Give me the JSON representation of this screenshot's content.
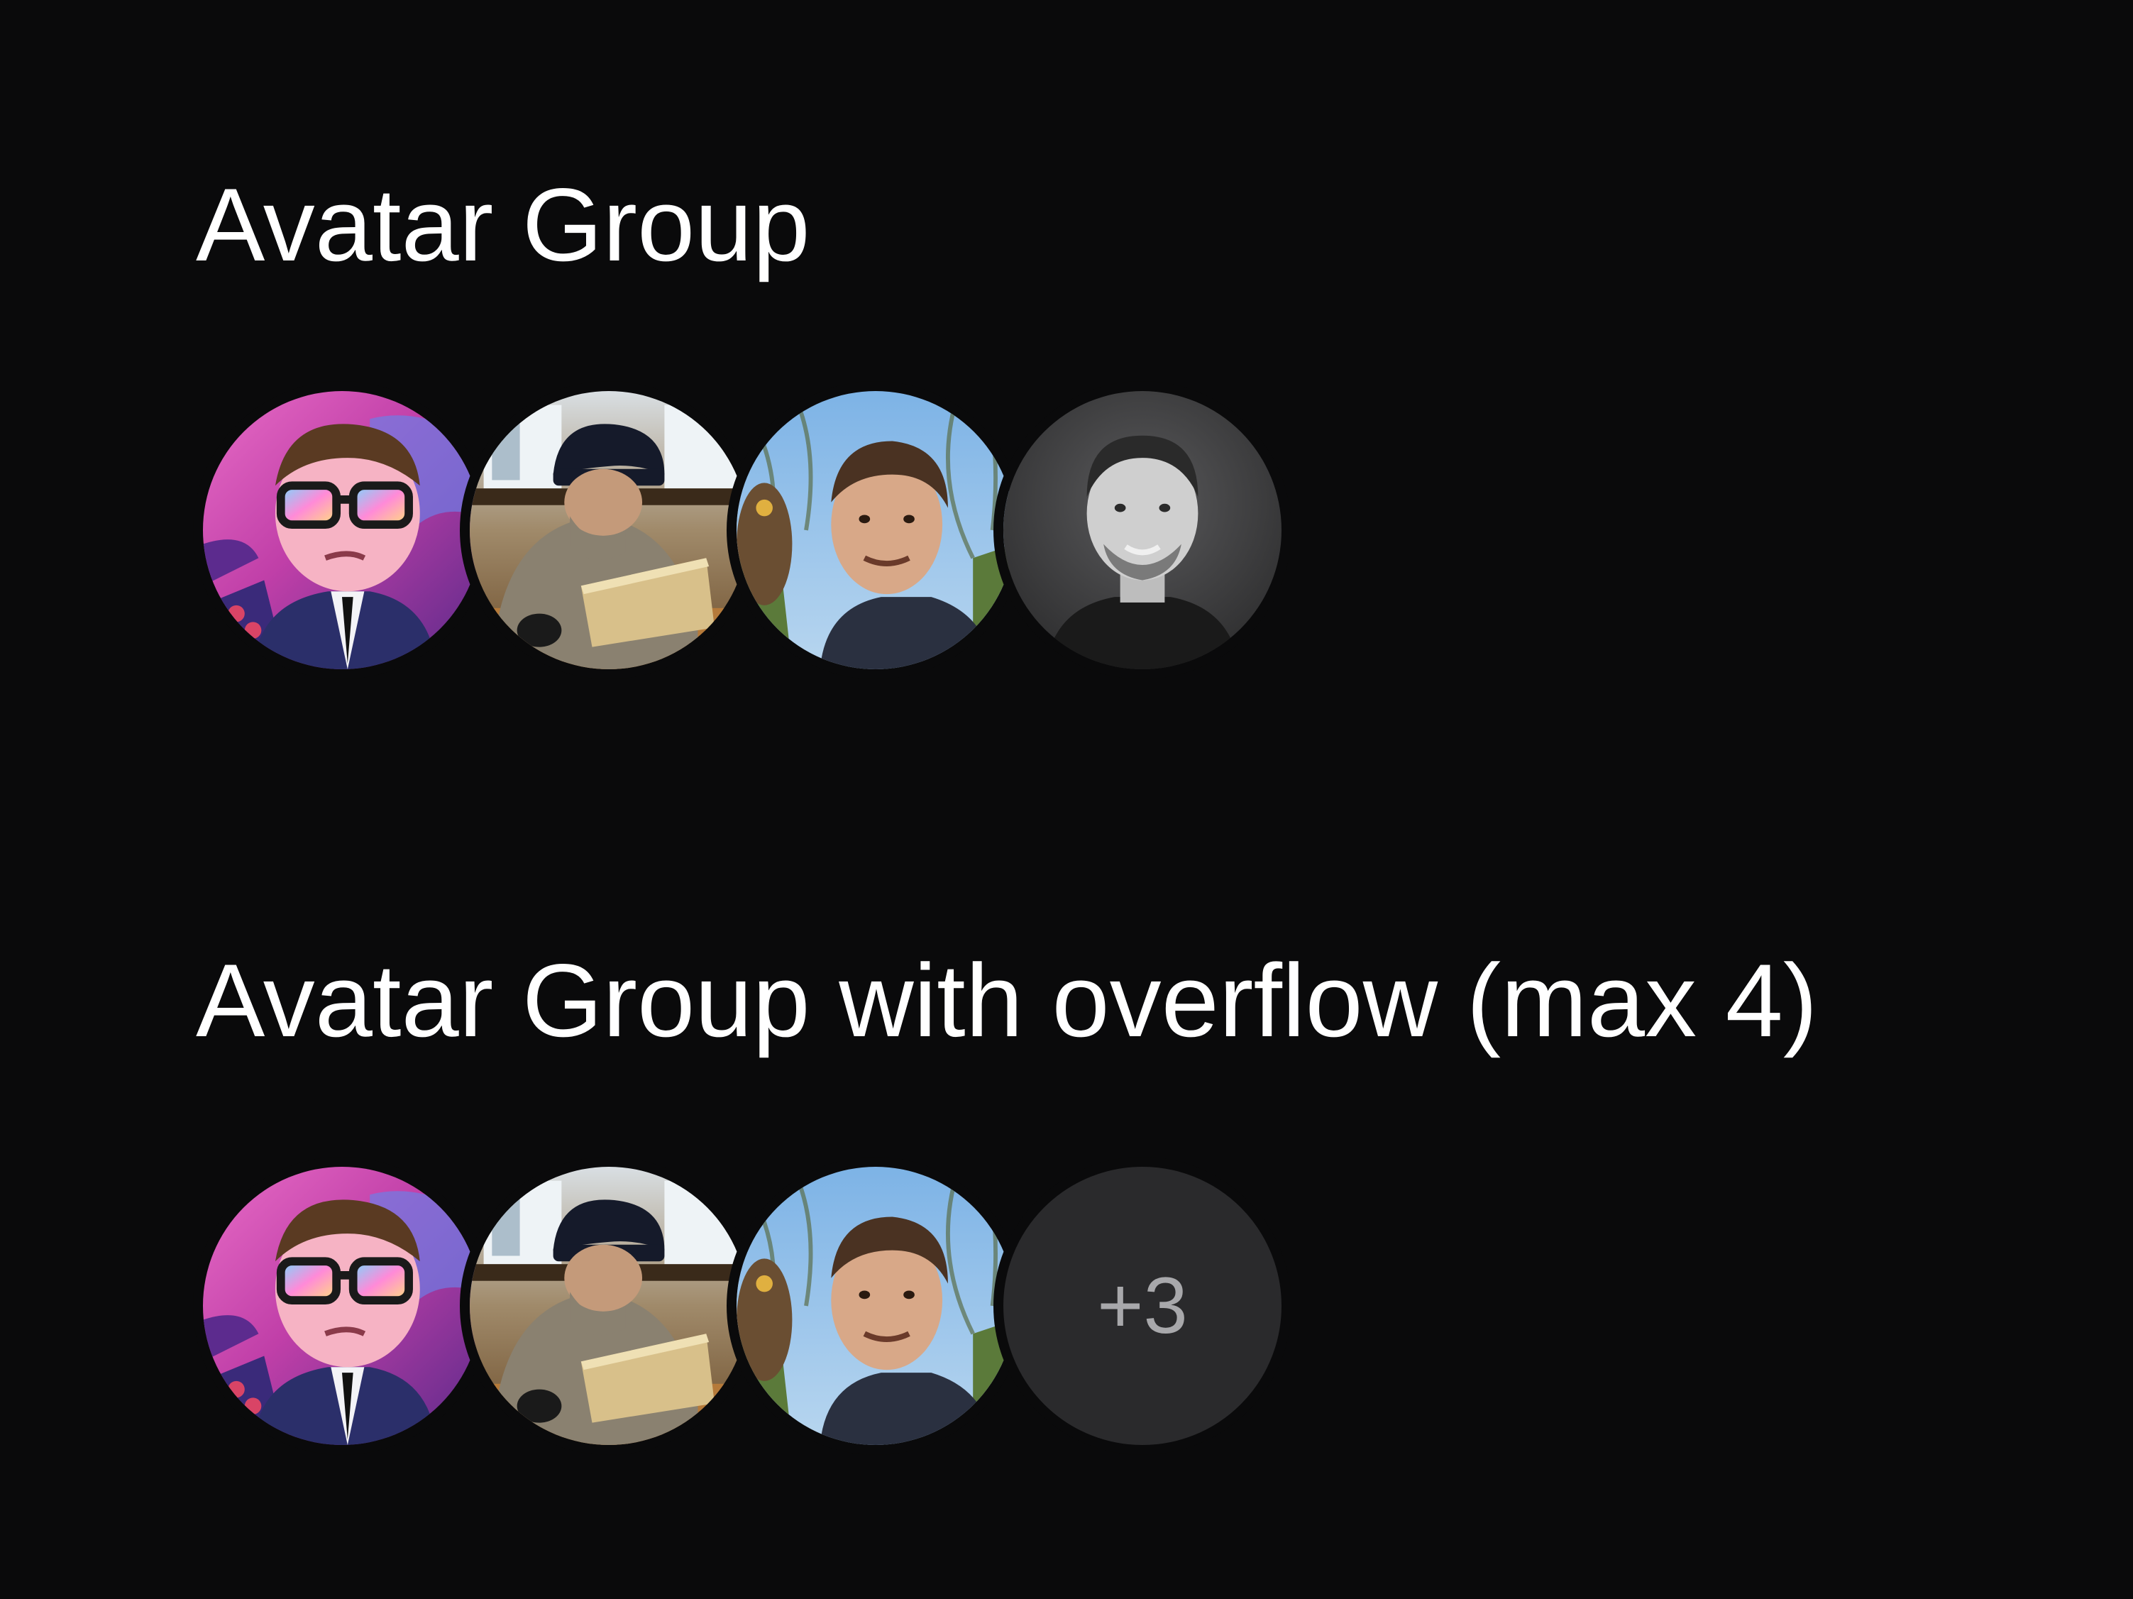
{
  "sections": [
    {
      "title": "Avatar Group",
      "avatars": [
        {
          "icon": "cartoon-sunglasses-avatar"
        },
        {
          "icon": "person-with-laptop-avatar"
        },
        {
          "icon": "man-with-owl-avatar"
        },
        {
          "icon": "bw-portrait-avatar"
        }
      ]
    },
    {
      "title": "Avatar Group with overflow (max 4)",
      "avatars": [
        {
          "icon": "cartoon-sunglasses-avatar"
        },
        {
          "icon": "person-with-laptop-avatar"
        },
        {
          "icon": "man-with-owl-avatar"
        }
      ],
      "overflow": "+3"
    }
  ],
  "colors": {
    "background": "#0a0a0b",
    "text": "#ffffff",
    "overflow_bg": "#2a2a2c",
    "overflow_text": "#a8a8ab"
  }
}
